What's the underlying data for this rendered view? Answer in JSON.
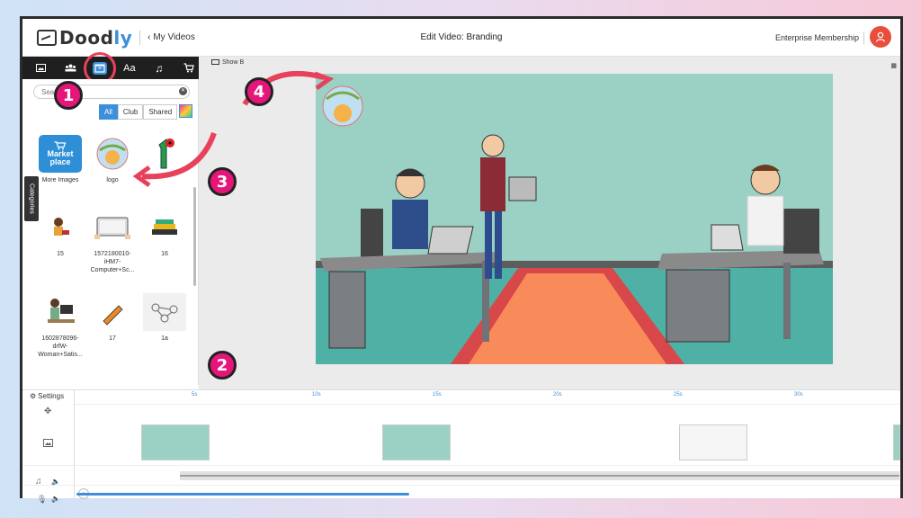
{
  "header": {
    "logo_text_main": "Dood",
    "logo_text_accent": "ly",
    "back_label": "My Videos",
    "title": "Edit Video: Branding",
    "membership": "Enterprise Membership"
  },
  "toolbar": {
    "tools": [
      "image-tab",
      "characters-tab",
      "assets-tab",
      "text-tab",
      "music-tab",
      "store-tab"
    ],
    "active": "assets-tab"
  },
  "panel": {
    "search_placeholder": "Search",
    "filters": [
      "All",
      "Club",
      "Shared"
    ],
    "active_filter": "All",
    "categories_label": "Categories",
    "items": [
      {
        "label": "More Images",
        "badge_line1": "Market",
        "badge_line2": "place"
      },
      {
        "label": "logo"
      },
      {
        "label": ""
      },
      {
        "label": "15"
      },
      {
        "label": "1572180010-iHM7-Computer+Sc..."
      },
      {
        "label": "16"
      },
      {
        "label": "1602878096-drfW-Woman+Satis..."
      },
      {
        "label": "17"
      },
      {
        "label": "1a"
      }
    ]
  },
  "canvas": {
    "show_label": "Show B"
  },
  "markers": [
    "1",
    "2",
    "3",
    "4"
  ],
  "timeline": {
    "settings_label": "Settings",
    "ruler_labels": [
      "5s",
      "10s",
      "15s",
      "20s",
      "25s",
      "30s"
    ]
  },
  "colors": {
    "accent": "#3d8fd9",
    "marker": "#e6157a",
    "arrow": "#e8415b",
    "scene_bg": "#9ad1c4"
  }
}
